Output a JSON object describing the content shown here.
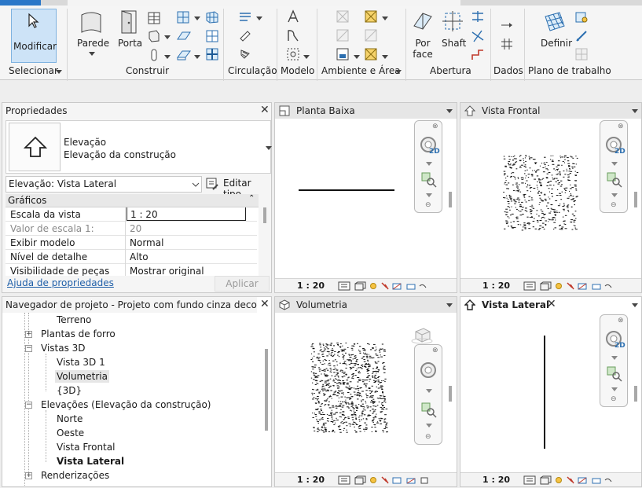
{
  "ribbon": {
    "modify_label": "Modificar",
    "select_label": "Selecionar",
    "wall_label": "Parede",
    "door_label": "Porta",
    "by_face_label": "Por face",
    "shaft_label": "Shaft",
    "define_label": "Definir",
    "panels": [
      "Construir",
      "Circulação",
      "Modelo",
      "Ambiente e Área",
      "Abertura",
      "Dados",
      "Plano de trabalho"
    ]
  },
  "properties": {
    "title": "Propriedades",
    "type_name": "Elevação",
    "type_sub": "Elevação da construção",
    "selector": "Elevação: Vista Lateral",
    "edit_type": "Editar tipo",
    "section": "Gráficos",
    "rows": [
      {
        "key": "Escala da vista",
        "value": "1 : 20"
      },
      {
        "key": "Valor de escala    1:",
        "value": "20"
      },
      {
        "key": "Exibir modelo",
        "value": "Normal"
      },
      {
        "key": "Nível de detalhe",
        "value": "Alto"
      },
      {
        "key": "Visibilidade de peças",
        "value": "Mostrar original"
      }
    ],
    "help_link": "Ajuda de propriedades",
    "apply": "Aplicar"
  },
  "browser": {
    "title": "Navegador de projeto - Projeto com fundo cinza decoraçõ...",
    "items": [
      {
        "label": "Terreno"
      },
      {
        "label": "Plantas de forro",
        "toggle": "+"
      },
      {
        "label": "Vistas 3D",
        "toggle": "−"
      },
      {
        "label": "Vista 3D 1"
      },
      {
        "label": "Volumetria"
      },
      {
        "label": "{3D}"
      },
      {
        "label": "Elevações (Elevação da construção)",
        "toggle": "−"
      },
      {
        "label": "Norte"
      },
      {
        "label": "Oeste"
      },
      {
        "label": "Vista Frontal"
      },
      {
        "label": "Vista Lateral"
      },
      {
        "label": "Renderizações",
        "toggle": "+"
      }
    ]
  },
  "views": {
    "planta": {
      "title": "Planta Baixa",
      "scale": "1 : 20"
    },
    "frontal": {
      "title": "Vista Frontal",
      "scale": "1 : 20"
    },
    "volumetria": {
      "title": "Volumetria",
      "scale": "1 : 20"
    },
    "lateral": {
      "title": "Vista Lateral",
      "scale": "1 : 20"
    },
    "nav_2d": "2D"
  }
}
